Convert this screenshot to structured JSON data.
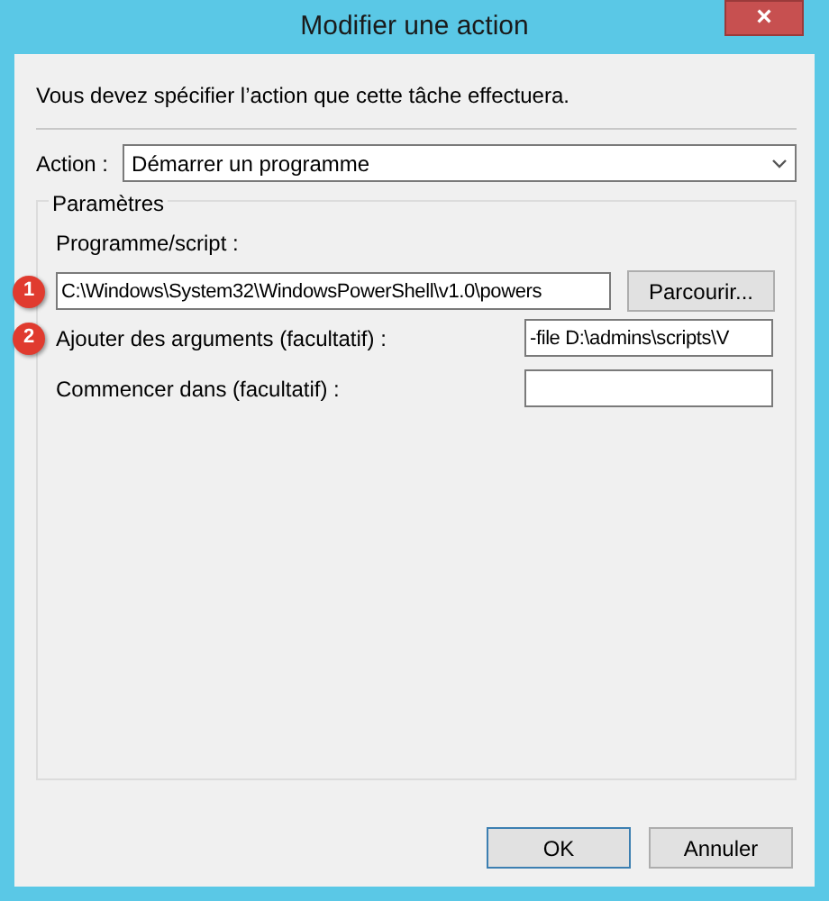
{
  "window": {
    "title": "Modifier une action",
    "close": "×"
  },
  "intro": "Vous devez spécifier l’action que cette tâche effectuera.",
  "action": {
    "label": "Action :",
    "value": "Démarrer un programme"
  },
  "group": {
    "title": "Paramètres",
    "program": {
      "label": "Programme/script :",
      "value": "C:\\Windows\\System32\\WindowsPowerShell\\v1.0\\powers",
      "marker": "1",
      "button": "Parcourir..."
    },
    "fields": [
      {
        "label": "Ajouter des arguments (facultatif) :",
        "value": "-file D:\\admins\\scripts\\V",
        "marker": "2"
      },
      {
        "label": "Commencer dans (facultatif) :"
      }
    ]
  },
  "buttons": [
    {
      "label": "OK",
      "default": true
    },
    {
      "label": "Annuler",
      "default": false
    }
  ]
}
